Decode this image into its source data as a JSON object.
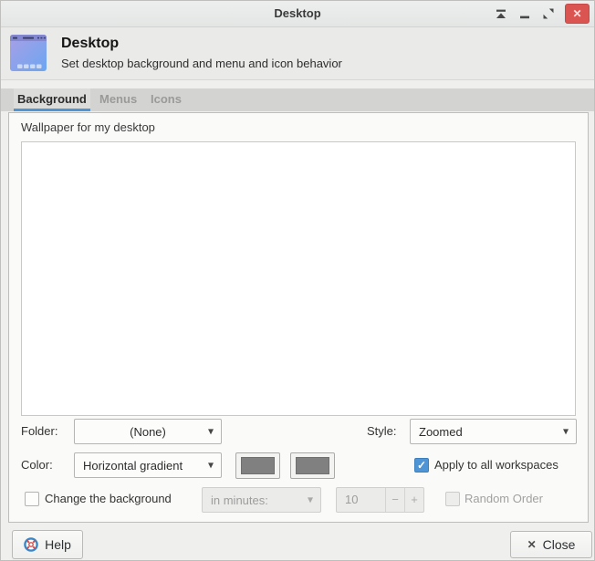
{
  "window": {
    "title": "Desktop",
    "controls": [
      "shade",
      "minimize",
      "unmaximize",
      "close"
    ]
  },
  "header": {
    "title": "Desktop",
    "subtitle": "Set desktop background and menu and icon behavior"
  },
  "tabs": [
    {
      "label": "Background",
      "active": true
    },
    {
      "label": "Menus",
      "active": false
    },
    {
      "label": "Icons",
      "active": false
    }
  ],
  "background_tab": {
    "wallpaper_label": "Wallpaper for my desktop",
    "folder_label": "Folder:",
    "folder_value": "(None)",
    "style_label": "Style:",
    "style_value": "Zoomed",
    "color_label": "Color:",
    "color_value": "Horizontal gradient",
    "gradient_color_1": "#808080",
    "gradient_color_2": "#808080",
    "apply_all_label": "Apply to all workspaces",
    "apply_all_checked": true,
    "change_label": "Change the background",
    "change_checked": false,
    "interval_unit_value": "in minutes:",
    "interval_number": "10",
    "random_label": "Random Order",
    "random_checked": false
  },
  "footer": {
    "help_label": "Help",
    "close_label": "Close"
  },
  "icons": {
    "combo_arrow": "▾",
    "check": "✓",
    "minus": "−",
    "plus": "+",
    "close_x": "✕",
    "titlebar_close_x": "✕"
  },
  "colors": {
    "accent": "#4f94d4",
    "titlebar_close_bg": "#da5452",
    "swatch": "#808080"
  }
}
